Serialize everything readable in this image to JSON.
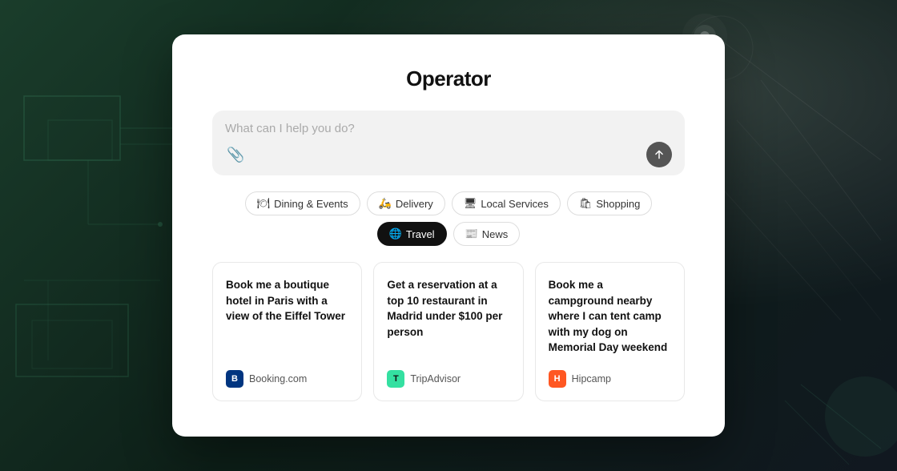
{
  "background": {
    "color": "#1a2e24"
  },
  "modal": {
    "title": "Operator",
    "search": {
      "placeholder": "What can I help you do?",
      "value": ""
    },
    "tabs": [
      {
        "id": "dining",
        "label": "Dining & Events",
        "icon": "🍽",
        "active": false
      },
      {
        "id": "delivery",
        "label": "Delivery",
        "icon": "🛵",
        "active": false
      },
      {
        "id": "local",
        "label": "Local Services",
        "icon": "🖥",
        "active": false
      },
      {
        "id": "shopping",
        "label": "Shopping",
        "icon": "🛍",
        "active": false
      },
      {
        "id": "travel",
        "label": "Travel",
        "icon": "🌐",
        "active": true
      },
      {
        "id": "news",
        "label": "News",
        "icon": "📰",
        "active": false
      }
    ],
    "cards": [
      {
        "id": "card-paris",
        "text": "Book me a boutique hotel in Paris with a view of the Eiffel Tower",
        "brand_id": "booking",
        "brand_name": "Booking.com",
        "brand_letter": "B"
      },
      {
        "id": "card-madrid",
        "text": "Get a reservation at a top 10 restaurant in Madrid under $100 per person",
        "brand_id": "tripadvisor",
        "brand_name": "TripAdvisor",
        "brand_letter": "T"
      },
      {
        "id": "card-campground",
        "text": "Book me a campground nearby where I can tent camp with my dog on Memorial Day weekend",
        "brand_id": "hipcamp",
        "brand_name": "Hipcamp",
        "brand_letter": "H"
      }
    ]
  }
}
